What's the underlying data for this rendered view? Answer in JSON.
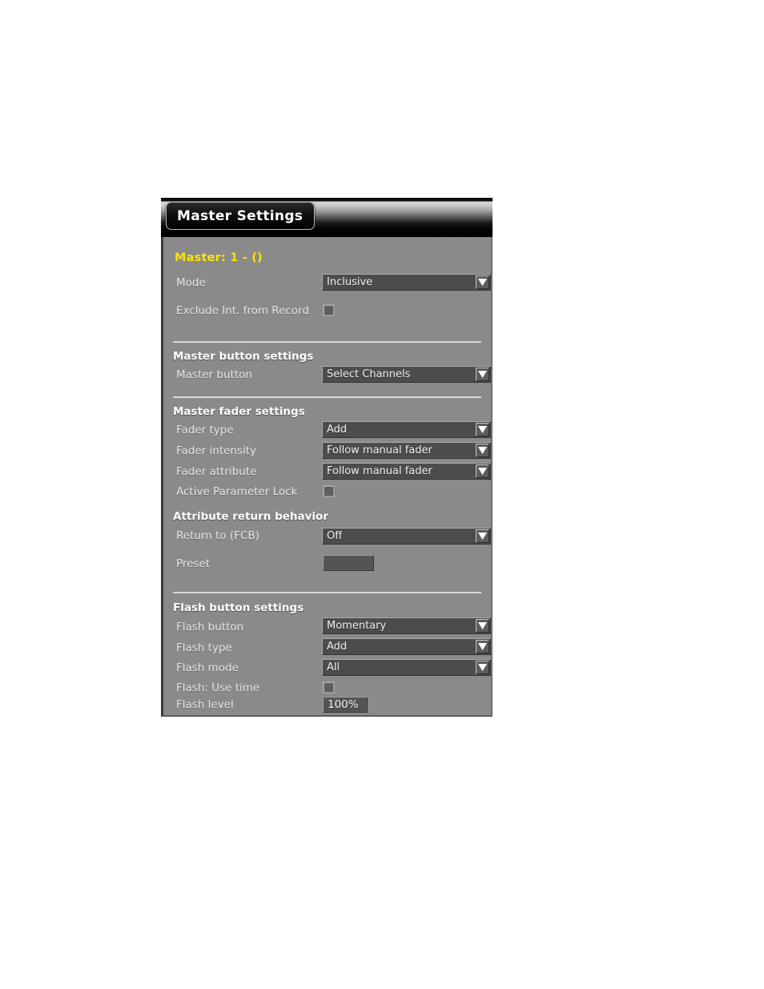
{
  "window": {
    "title": "Master Settings"
  },
  "master": {
    "heading": "Master: 1 - ()"
  },
  "general": {
    "mode": {
      "label": "Mode",
      "value": "Inclusive"
    },
    "exclude_int_from_record": {
      "label": "Exclude Int. from Record",
      "checked": false
    }
  },
  "master_button_settings": {
    "section_title": "Master button settings",
    "master_button": {
      "label": "Master button",
      "value": "Select Channels"
    }
  },
  "master_fader_settings": {
    "section_title": "Master fader settings",
    "fader_type": {
      "label": "Fader type",
      "value": "Add"
    },
    "fader_intensity": {
      "label": "Fader intensity",
      "value": "Follow manual fader"
    },
    "fader_attribute": {
      "label": "Fader attribute",
      "value": "Follow manual fader"
    },
    "active_parameter_lock": {
      "label": "Active Parameter Lock",
      "checked": false
    }
  },
  "attribute_return_behavior": {
    "section_title": "Attribute return behavior",
    "return_to_fcb": {
      "label": "Return to (FCB)",
      "value": "Off"
    },
    "preset": {
      "label": "Preset",
      "value": ""
    }
  },
  "flash_button_settings": {
    "section_title": "Flash button settings",
    "flash_button": {
      "label": "Flash button",
      "value": "Momentary"
    },
    "flash_type": {
      "label": "Flash type",
      "value": "Add"
    },
    "flash_mode": {
      "label": "Flash mode",
      "value": "All"
    },
    "flash_use_time": {
      "label": "Flash: Use time",
      "checked": false
    },
    "flash_level": {
      "label": "Flash level",
      "value": "100%"
    }
  },
  "icons": {
    "dropdown_arrow": "chevron-down-icon"
  },
  "colors": {
    "panel_background": "#8a8a8a",
    "accent_heading": "#ffe400",
    "control_fill": "#4c4c4c",
    "divider": "#d7d7d7",
    "title_text": "#ffffff"
  }
}
